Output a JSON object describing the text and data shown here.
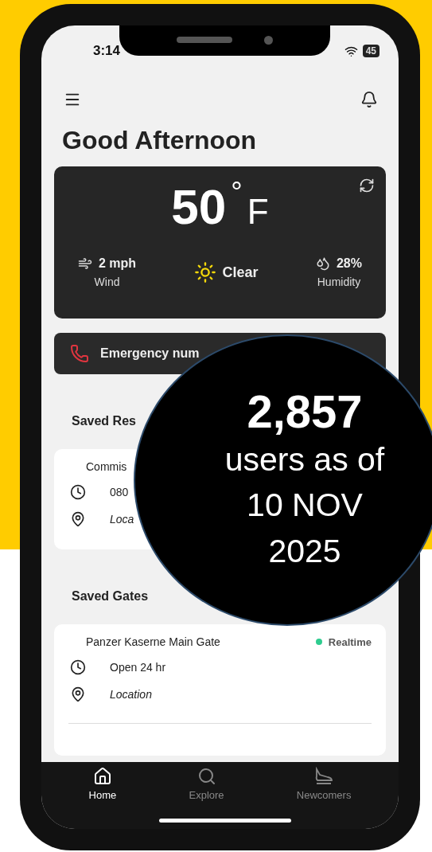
{
  "status_bar": {
    "time": "3:14",
    "battery": "45"
  },
  "header": {
    "greeting": "Good Afternoon"
  },
  "weather": {
    "temperature": "50",
    "degree": "°",
    "unit": "F",
    "stats": [
      {
        "kind": "wind",
        "value": "2 mph",
        "label": "Wind"
      },
      {
        "kind": "condition",
        "value": "Clear"
      },
      {
        "kind": "humidity",
        "value": "28%",
        "label": "Humidity"
      }
    ]
  },
  "emergency_button": {
    "label": "Emergency num"
  },
  "saved_restaurants": {
    "title": "Saved Res",
    "items": [
      {
        "name": "Commis",
        "hours": "080",
        "location": "Loca"
      }
    ]
  },
  "saved_gates": {
    "title": "Saved Gates",
    "items": [
      {
        "name": "Panzer Kaserne Main Gate",
        "status": "Realtime",
        "color": "#2ecc8f",
        "hours": "Open 24 hr",
        "location": "Location"
      }
    ]
  },
  "tab_bar": [
    {
      "kind": "home",
      "label": "Home",
      "selected": true
    },
    {
      "kind": "explore",
      "label": "Explore",
      "selected": false
    },
    {
      "kind": "newcomers",
      "label": "Newcomers",
      "selected": false
    }
  ],
  "overlay": {
    "count": "2,857",
    "lines": [
      "users as of",
      "10 NOV",
      "2025"
    ]
  }
}
